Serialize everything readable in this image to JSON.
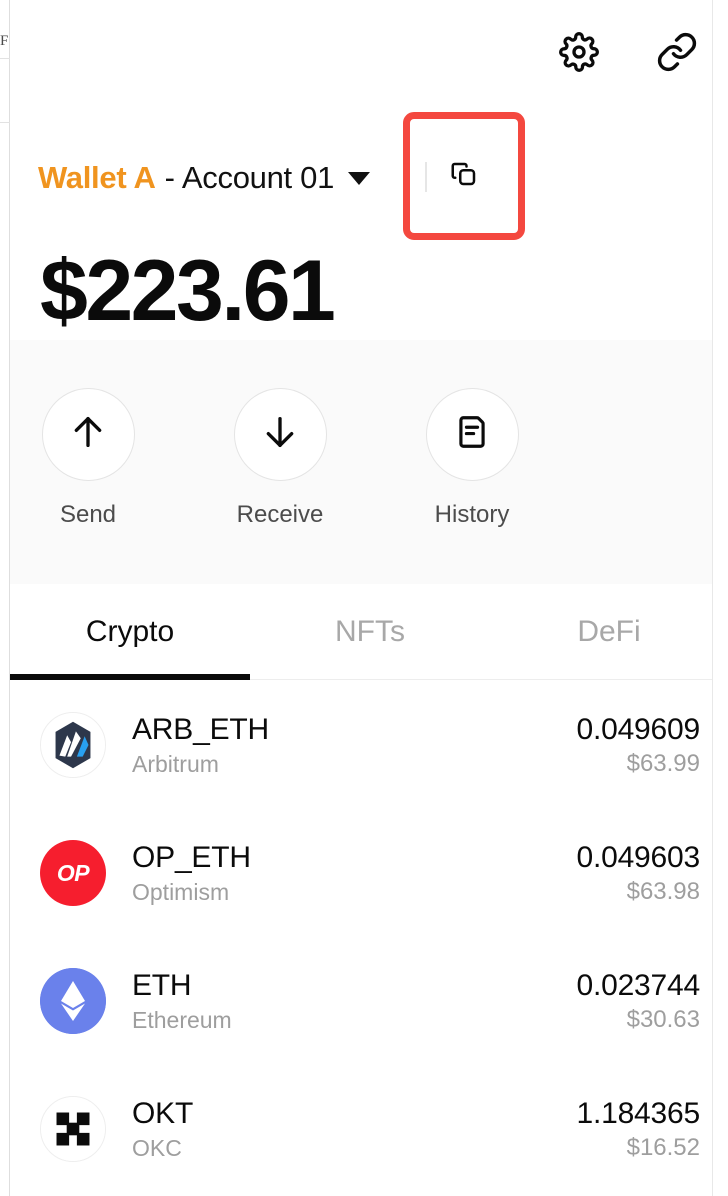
{
  "topbar": {
    "settings_icon": "gear-icon",
    "connect_icon": "link-icon"
  },
  "account": {
    "wallet_name": "Wallet A",
    "separator": "-",
    "account_name": "Account 01",
    "caret_icon": "chevron-down-icon",
    "copy_icon": "copy-icon",
    "highlight_color": "#F4483F",
    "wallet_name_color": "#F0941F"
  },
  "balance": {
    "total": "$223.61"
  },
  "actions": [
    {
      "label": "Send",
      "icon": "arrow-up-icon"
    },
    {
      "label": "Receive",
      "icon": "arrow-down-icon"
    },
    {
      "label": "History",
      "icon": "document-icon"
    }
  ],
  "tabs": [
    {
      "label": "Crypto",
      "active": true
    },
    {
      "label": "NFTs",
      "active": false
    },
    {
      "label": "DeFi",
      "active": false
    }
  ],
  "tokens": [
    {
      "symbol": "ARB_ETH",
      "network": "Arbitrum",
      "amount": "0.049609",
      "fiat": "$63.99",
      "logo": "arbitrum-logo"
    },
    {
      "symbol": "OP_ETH",
      "network": "Optimism",
      "amount": "0.049603",
      "fiat": "$63.98",
      "logo": "optimism-logo",
      "logo_text": "OP"
    },
    {
      "symbol": "ETH",
      "network": "Ethereum",
      "amount": "0.023744",
      "fiat": "$30.63",
      "logo": "ethereum-logo"
    },
    {
      "symbol": "OKT",
      "network": "OKC",
      "amount": "1.184365",
      "fiat": "$16.52",
      "logo": "okc-logo"
    }
  ]
}
